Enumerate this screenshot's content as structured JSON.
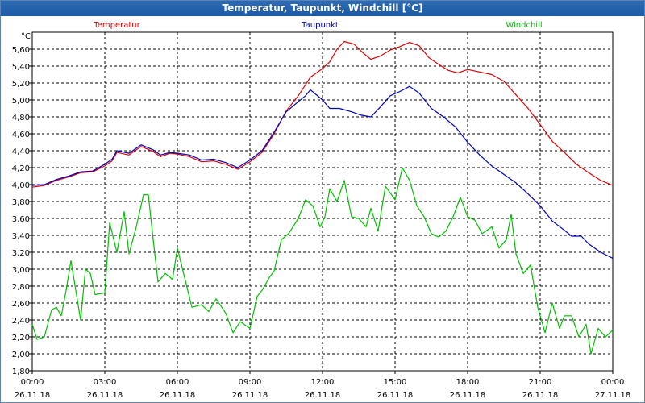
{
  "window": {
    "title": "Temperatur, Taupunkt, Windchill [°C]"
  },
  "chart_data": {
    "type": "line",
    "title": "Temperatur, Taupunkt, Windchill [°C]",
    "ylabel": "°C",
    "ylim": [
      1.8,
      5.8
    ],
    "xlim": [
      0,
      24
    ],
    "grid": true,
    "legend_position": "top",
    "y_ticks": [
      "1,80",
      "2,00",
      "2,20",
      "2,40",
      "2,60",
      "2,80",
      "3,00",
      "3,20",
      "3,40",
      "3,60",
      "3,80",
      "4,00",
      "4,20",
      "4,40",
      "4,60",
      "4,80",
      "5,00",
      "5,20",
      "5,40",
      "5,60"
    ],
    "x_ticks": [
      {
        "time": "00:00",
        "date": "26.11.18",
        "x": 0
      },
      {
        "time": "03:00",
        "date": "26.11.18",
        "x": 3
      },
      {
        "time": "06:00",
        "date": "26.11.18",
        "x": 6
      },
      {
        "time": "09:00",
        "date": "26.11.18",
        "x": 9
      },
      {
        "time": "12:00",
        "date": "26.11.18",
        "x": 12
      },
      {
        "time": "15:00",
        "date": "26.11.18",
        "x": 15
      },
      {
        "time": "18:00",
        "date": "26.11.18",
        "x": 18
      },
      {
        "time": "21:00",
        "date": "26.11.18",
        "x": 21
      },
      {
        "time": "00:00",
        "date": "27.11.18",
        "x": 24
      }
    ],
    "series": [
      {
        "name": "Temperatur",
        "color": "#e00000",
        "points": [
          [
            0,
            3.97
          ],
          [
            0.5,
            3.99
          ],
          [
            1,
            4.05
          ],
          [
            1.5,
            4.09
          ],
          [
            2,
            4.14
          ],
          [
            2.5,
            4.15
          ],
          [
            3,
            4.22
          ],
          [
            3.3,
            4.28
          ],
          [
            3.5,
            4.38
          ],
          [
            4,
            4.35
          ],
          [
            4.5,
            4.45
          ],
          [
            5,
            4.39
          ],
          [
            5.3,
            4.33
          ],
          [
            5.7,
            4.37
          ],
          [
            6,
            4.36
          ],
          [
            6.5,
            4.33
          ],
          [
            7,
            4.27
          ],
          [
            7.5,
            4.28
          ],
          [
            8,
            4.24
          ],
          [
            8.5,
            4.18
          ],
          [
            9,
            4.27
          ],
          [
            9.5,
            4.38
          ],
          [
            10,
            4.6
          ],
          [
            10.5,
            4.87
          ],
          [
            11,
            5.05
          ],
          [
            11.3,
            5.18
          ],
          [
            11.5,
            5.27
          ],
          [
            12,
            5.37
          ],
          [
            12.3,
            5.45
          ],
          [
            12.6,
            5.6
          ],
          [
            12.9,
            5.69
          ],
          [
            13.3,
            5.66
          ],
          [
            13.7,
            5.55
          ],
          [
            14,
            5.48
          ],
          [
            14.4,
            5.52
          ],
          [
            14.8,
            5.59
          ],
          [
            15.2,
            5.63
          ],
          [
            15.6,
            5.68
          ],
          [
            16,
            5.64
          ],
          [
            16.4,
            5.5
          ],
          [
            16.8,
            5.42
          ],
          [
            17.2,
            5.35
          ],
          [
            17.6,
            5.32
          ],
          [
            18,
            5.36
          ],
          [
            18.5,
            5.33
          ],
          [
            19,
            5.3
          ],
          [
            19.5,
            5.22
          ],
          [
            20,
            5.06
          ],
          [
            20.5,
            4.9
          ],
          [
            21,
            4.71
          ],
          [
            21.5,
            4.51
          ],
          [
            22,
            4.38
          ],
          [
            22.5,
            4.24
          ],
          [
            23,
            4.14
          ],
          [
            23.5,
            4.05
          ],
          [
            24,
            3.99
          ]
        ]
      },
      {
        "name": "Taupunkt",
        "color": "#0000c0",
        "points": [
          [
            0,
            3.99
          ],
          [
            0.5,
            4.0
          ],
          [
            1,
            4.06
          ],
          [
            1.5,
            4.1
          ],
          [
            2,
            4.15
          ],
          [
            2.5,
            4.16
          ],
          [
            3,
            4.24
          ],
          [
            3.3,
            4.3
          ],
          [
            3.5,
            4.4
          ],
          [
            4,
            4.37
          ],
          [
            4.5,
            4.47
          ],
          [
            5,
            4.41
          ],
          [
            5.3,
            4.35
          ],
          [
            5.7,
            4.38
          ],
          [
            6,
            4.37
          ],
          [
            6.5,
            4.35
          ],
          [
            7,
            4.29
          ],
          [
            7.5,
            4.3
          ],
          [
            8,
            4.26
          ],
          [
            8.5,
            4.2
          ],
          [
            9,
            4.29
          ],
          [
            9.5,
            4.4
          ],
          [
            10,
            4.62
          ],
          [
            10.5,
            4.86
          ],
          [
            11,
            4.98
          ],
          [
            11.3,
            5.05
          ],
          [
            11.5,
            5.12
          ],
          [
            12,
            5.0
          ],
          [
            12.3,
            4.9
          ],
          [
            12.7,
            4.9
          ],
          [
            13.2,
            4.86
          ],
          [
            13.6,
            4.82
          ],
          [
            14,
            4.8
          ],
          [
            14.4,
            4.92
          ],
          [
            14.8,
            5.05
          ],
          [
            15.2,
            5.1
          ],
          [
            15.6,
            5.16
          ],
          [
            16,
            5.08
          ],
          [
            16.5,
            4.9
          ],
          [
            17,
            4.8
          ],
          [
            17.5,
            4.68
          ],
          [
            18,
            4.5
          ],
          [
            18.5,
            4.35
          ],
          [
            19,
            4.22
          ],
          [
            19.5,
            4.12
          ],
          [
            20,
            4.02
          ],
          [
            20.5,
            3.89
          ],
          [
            21,
            3.75
          ],
          [
            21.5,
            3.57
          ],
          [
            22,
            3.46
          ],
          [
            22.3,
            3.39
          ],
          [
            22.7,
            3.39
          ],
          [
            23,
            3.3
          ],
          [
            23.5,
            3.2
          ],
          [
            24,
            3.13
          ]
        ]
      },
      {
        "name": "Windchill",
        "color": "#00c000",
        "points": [
          [
            0,
            2.35
          ],
          [
            0.2,
            2.17
          ],
          [
            0.5,
            2.2
          ],
          [
            0.8,
            2.52
          ],
          [
            1,
            2.55
          ],
          [
            1.2,
            2.45
          ],
          [
            1.4,
            2.75
          ],
          [
            1.6,
            3.1
          ],
          [
            1.8,
            2.75
          ],
          [
            2,
            2.4
          ],
          [
            2.2,
            3.0
          ],
          [
            2.4,
            2.95
          ],
          [
            2.6,
            2.7
          ],
          [
            3,
            2.72
          ],
          [
            3.2,
            3.55
          ],
          [
            3.5,
            3.2
          ],
          [
            3.8,
            3.68
          ],
          [
            4,
            3.18
          ],
          [
            4.3,
            3.5
          ],
          [
            4.6,
            3.88
          ],
          [
            4.8,
            3.88
          ],
          [
            5,
            3.35
          ],
          [
            5.2,
            2.85
          ],
          [
            5.5,
            2.95
          ],
          [
            5.8,
            2.88
          ],
          [
            6,
            3.25
          ],
          [
            6.3,
            2.9
          ],
          [
            6.6,
            2.55
          ],
          [
            7,
            2.58
          ],
          [
            7.3,
            2.5
          ],
          [
            7.6,
            2.65
          ],
          [
            8,
            2.48
          ],
          [
            8.3,
            2.25
          ],
          [
            8.6,
            2.38
          ],
          [
            9,
            2.3
          ],
          [
            9.3,
            2.68
          ],
          [
            9.5,
            2.75
          ],
          [
            9.8,
            2.9
          ],
          [
            10,
            2.98
          ],
          [
            10.3,
            3.35
          ],
          [
            10.6,
            3.42
          ],
          [
            11,
            3.6
          ],
          [
            11.3,
            3.82
          ],
          [
            11.6,
            3.75
          ],
          [
            11.9,
            3.5
          ],
          [
            12.1,
            3.62
          ],
          [
            12.3,
            3.95
          ],
          [
            12.6,
            3.8
          ],
          [
            12.9,
            4.05
          ],
          [
            13.2,
            3.62
          ],
          [
            13.5,
            3.6
          ],
          [
            13.8,
            3.5
          ],
          [
            14,
            3.72
          ],
          [
            14.3,
            3.45
          ],
          [
            14.6,
            3.98
          ],
          [
            15,
            3.82
          ],
          [
            15.3,
            4.2
          ],
          [
            15.6,
            4.05
          ],
          [
            15.9,
            3.75
          ],
          [
            16.2,
            3.62
          ],
          [
            16.5,
            3.42
          ],
          [
            16.8,
            3.38
          ],
          [
            17.1,
            3.45
          ],
          [
            17.4,
            3.62
          ],
          [
            17.7,
            3.85
          ],
          [
            18,
            3.62
          ],
          [
            18.3,
            3.58
          ],
          [
            18.6,
            3.42
          ],
          [
            19,
            3.5
          ],
          [
            19.3,
            3.25
          ],
          [
            19.6,
            3.35
          ],
          [
            19.8,
            3.65
          ],
          [
            20,
            3.18
          ],
          [
            20.3,
            2.95
          ],
          [
            20.6,
            3.05
          ],
          [
            20.9,
            2.55
          ],
          [
            21.2,
            2.25
          ],
          [
            21.5,
            2.6
          ],
          [
            21.8,
            2.3
          ],
          [
            22,
            2.45
          ],
          [
            22.3,
            2.45
          ],
          [
            22.6,
            2.2
          ],
          [
            22.9,
            2.35
          ],
          [
            23.1,
            2.0
          ],
          [
            23.4,
            2.3
          ],
          [
            23.7,
            2.2
          ],
          [
            24,
            2.28
          ]
        ]
      }
    ]
  }
}
